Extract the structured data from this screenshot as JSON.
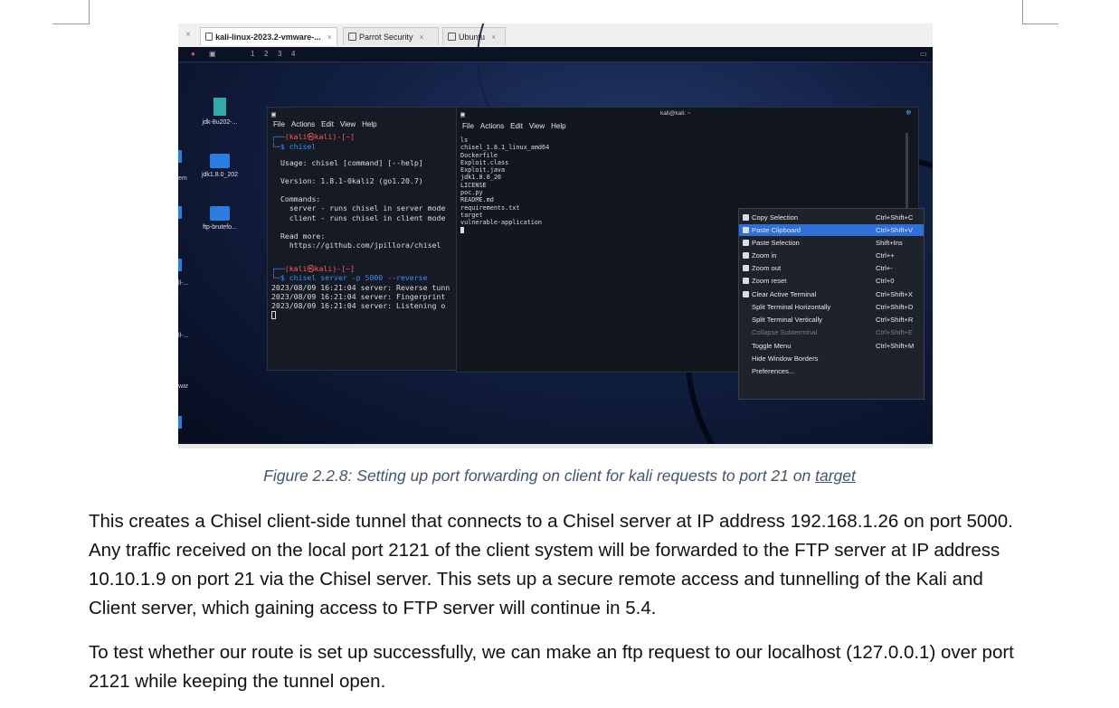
{
  "screenshot": {
    "tabs": [
      {
        "label": "kali-linux-2023.2-vmware-...",
        "active": true
      },
      {
        "label": "Parrot Security",
        "active": false
      },
      {
        "label": "Ubuntu",
        "active": false
      }
    ],
    "workspaces": [
      "1",
      "2",
      "3",
      "4"
    ],
    "desktop_icons": [
      "jdk-8u202-...",
      "jdk1.8.0_202",
      "ftp-brutefo..."
    ],
    "edge_labels": [
      "em",
      "ll-...",
      "ll-...",
      "war"
    ],
    "term1": {
      "menu": [
        "File",
        "Actions",
        "Edit",
        "View",
        "Help"
      ],
      "prompt_user": "(kali㉿kali)-[~]",
      "cmd1": "$ chisel",
      "usage": "Usage: chisel [command] [--help]",
      "version": "Version: 1.8.1-0kali2 (go1.20.7)",
      "commands_hdr": "Commands:",
      "cmd_server": "  server - runs chisel in server mode",
      "cmd_client": "  client - runs chisel in client mode",
      "readmore": "Read more:",
      "url": "  https://github.com/jpillora/chisel",
      "prompt_user2": "(kali㉿kali)-[~]",
      "cmd2": "$ chisel server -p 5000 --reverse",
      "log1": "2023/08/09 16:21:04 server: Reverse tunn",
      "log2": "2023/08/09 16:21:04 server: Fingerprint",
      "log3": "2023/08/09 16:21:04 server: Listening o"
    },
    "term2": {
      "title": "kali@kali: ~",
      "menu": [
        "File",
        "Actions",
        "Edit",
        "View",
        "Help"
      ],
      "lines": [
        "ls",
        "chisel_1.8.1_linux_amd64",
        "Dockerfile",
        "Exploit.class",
        "Exploit.java",
        "jdk1.8.0_20",
        "LICENSE",
        "poc.py",
        "README.md",
        "requirements.txt",
        "target",
        "vulnerable-application"
      ]
    },
    "context_menu": [
      {
        "label": "Copy Selection",
        "shortcut": "Ctrl+Shift+C",
        "icon": "copy-icon",
        "state": "normal"
      },
      {
        "label": "Paste Clipboard",
        "shortcut": "Ctrl+Shift+V",
        "icon": "paste-icon",
        "state": "selected"
      },
      {
        "label": "Paste Selection",
        "shortcut": "Shift+Ins",
        "icon": "paste-icon",
        "state": "normal"
      },
      {
        "label": "Zoom in",
        "shortcut": "Ctrl++",
        "icon": "zoom-in-icon",
        "state": "normal"
      },
      {
        "label": "Zoom out",
        "shortcut": "Ctrl+-",
        "icon": "zoom-out-icon",
        "state": "normal"
      },
      {
        "label": "Zoom reset",
        "shortcut": "Ctrl+0",
        "icon": "zoom-reset-icon",
        "state": "normal"
      },
      {
        "label": "Clear Active Terminal",
        "shortcut": "Ctrl+Shift+X",
        "icon": "clear-icon",
        "state": "normal"
      },
      {
        "label": "Split Terminal Horizontally",
        "shortcut": "Ctrl+Shift+D",
        "icon": "",
        "state": "normal"
      },
      {
        "label": "Split Terminal Vertically",
        "shortcut": "Ctrl+Shift+R",
        "icon": "",
        "state": "normal"
      },
      {
        "label": "Collapse Subterminal",
        "shortcut": "Ctrl+Shift+E",
        "icon": "",
        "state": "disabled"
      },
      {
        "label": "Toggle Menu",
        "shortcut": "Ctrl+Shift+M",
        "icon": "",
        "state": "normal"
      },
      {
        "label": "Hide Window Borders",
        "shortcut": "",
        "icon": "",
        "state": "normal"
      },
      {
        "label": "Preferences...",
        "shortcut": "",
        "icon": "",
        "state": "normal"
      }
    ]
  },
  "caption": {
    "text": "Figure 2.2.8: Setting up port forwarding on client for kali requests to port 21 on ",
    "link": "target"
  },
  "paragraphs": [
    "This creates a Chisel client-side tunnel that connects to a Chisel server at IP address 192.168.1.26 on port 5000. Any traffic received on the local port 2121 of the client system will be forwarded to the FTP server at IP address 10.10.1.9 on port 21 via the Chisel server. This sets up a secure remote access and tunnelling of the Kali and Client server, which gaining access to FTP server will continue in 5.4.",
    "To test whether our route is set up successfully, we can make an ftp request to our localhost (127.0.0.1) over port 2121 while keeping the tunnel open."
  ]
}
